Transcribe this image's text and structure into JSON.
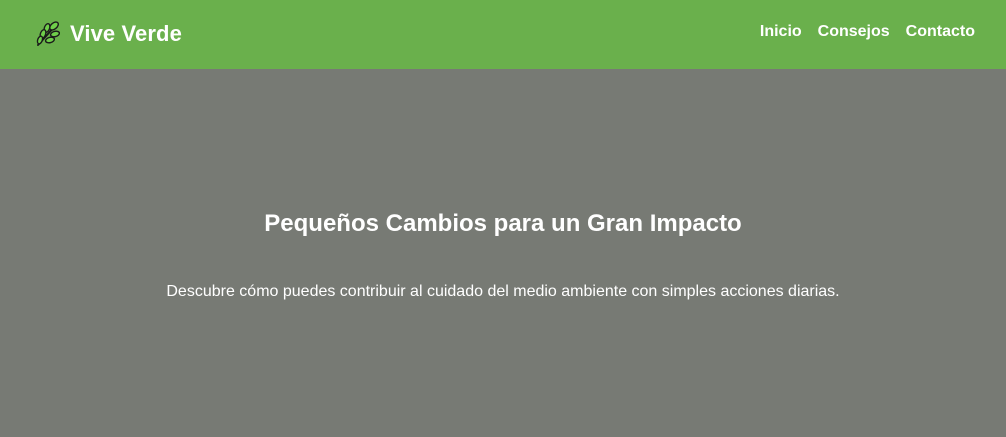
{
  "navbar": {
    "brand": {
      "icon": "leaf-icon",
      "title": "Vive Verde"
    },
    "links": [
      {
        "label": "Inicio"
      },
      {
        "label": "Consejos"
      },
      {
        "label": "Contacto"
      }
    ]
  },
  "hero": {
    "title": "Pequeños Cambios para un Gran Impacto",
    "subtitle": "Descubre cómo puedes contribuir al cuidado del medio ambiente con simples acciones diarias."
  },
  "colors": {
    "navbar_bg": "#6ab04c",
    "hero_bg": "#777a74",
    "text": "#ffffff",
    "leaf_fill": "#6fcf4a",
    "leaf_outline": "#1b1b1b"
  }
}
